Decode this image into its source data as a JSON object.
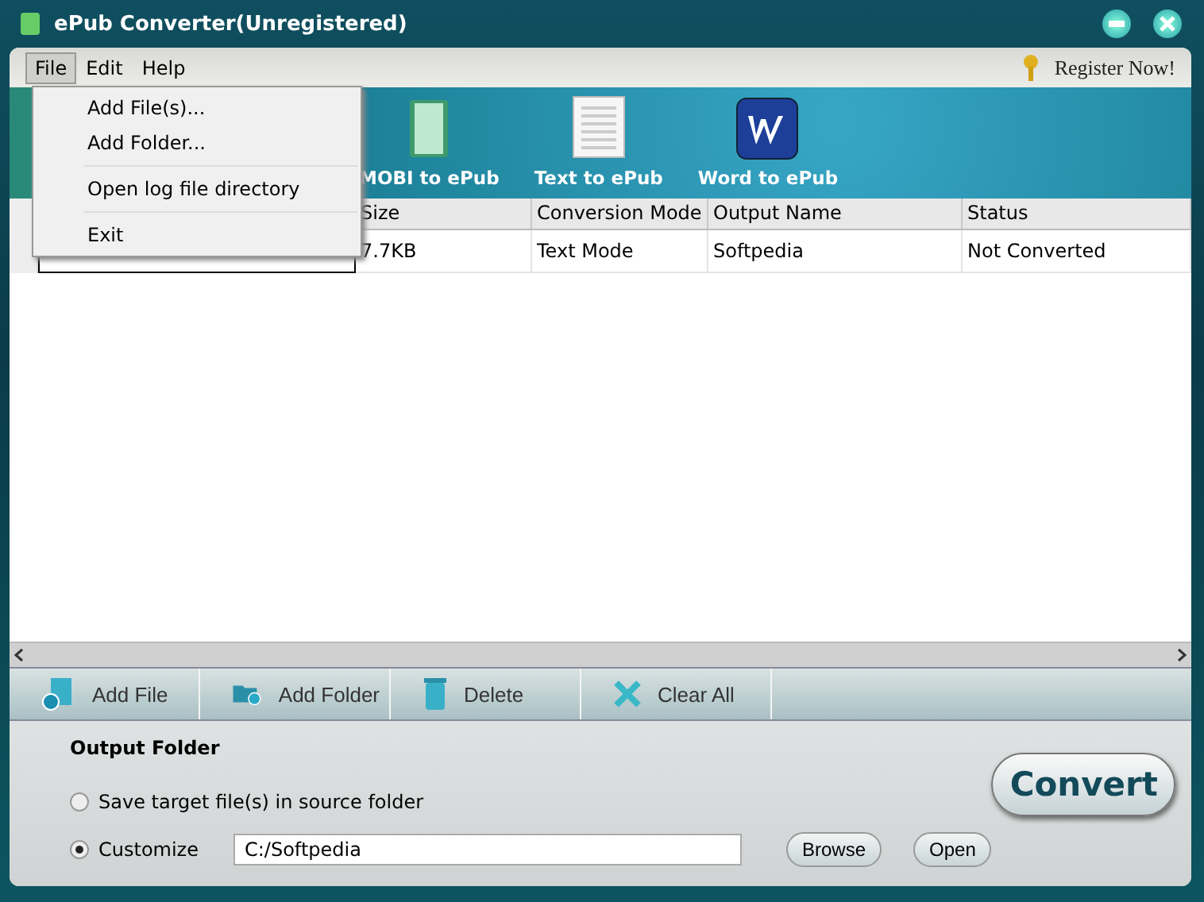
{
  "window": {
    "title": "ePub Converter(Unregistered)"
  },
  "menu_bar": [
    {
      "label": "File",
      "selected": true
    },
    {
      "label": "Edit",
      "selected": false
    },
    {
      "label": "Help",
      "selected": false
    }
  ],
  "register": "Register  Now!",
  "file_menu": [
    {
      "label": "Add File(s)..."
    },
    {
      "label": "Add Folder..."
    },
    {
      "kind": "separator"
    },
    {
      "label": "Open log file directory"
    },
    {
      "kind": "separator"
    },
    {
      "label": "Exit"
    }
  ],
  "toolbar": [
    {
      "kind": "mobi",
      "label": "MOBI to ePub"
    },
    {
      "kind": "text",
      "label": "Text to ePub"
    },
    {
      "kind": "word",
      "label": "Word to ePub"
    }
  ],
  "table": {
    "columns": [
      "Size",
      "Conversion Mode",
      "Output Name",
      "Status"
    ],
    "rows": [
      {
        "cells": [
          "7.7KB",
          "Text Mode",
          "Softpedia",
          "Not Converted"
        ]
      }
    ]
  },
  "actions": [
    {
      "kind": "add-file",
      "label": "Add File"
    },
    {
      "kind": "add-folder",
      "label": "Add Folder"
    },
    {
      "kind": "delete",
      "label": "Delete"
    },
    {
      "kind": "clear",
      "label": "Clear All"
    }
  ],
  "output": {
    "title": "Output Folder",
    "options": [
      {
        "label": "Save target file(s) in source folder",
        "selected": false
      },
      {
        "label": "Customize",
        "selected": true
      }
    ],
    "path": "C:/Softpedia",
    "browse": "Browse",
    "open": "Open",
    "convert": "Convert"
  }
}
